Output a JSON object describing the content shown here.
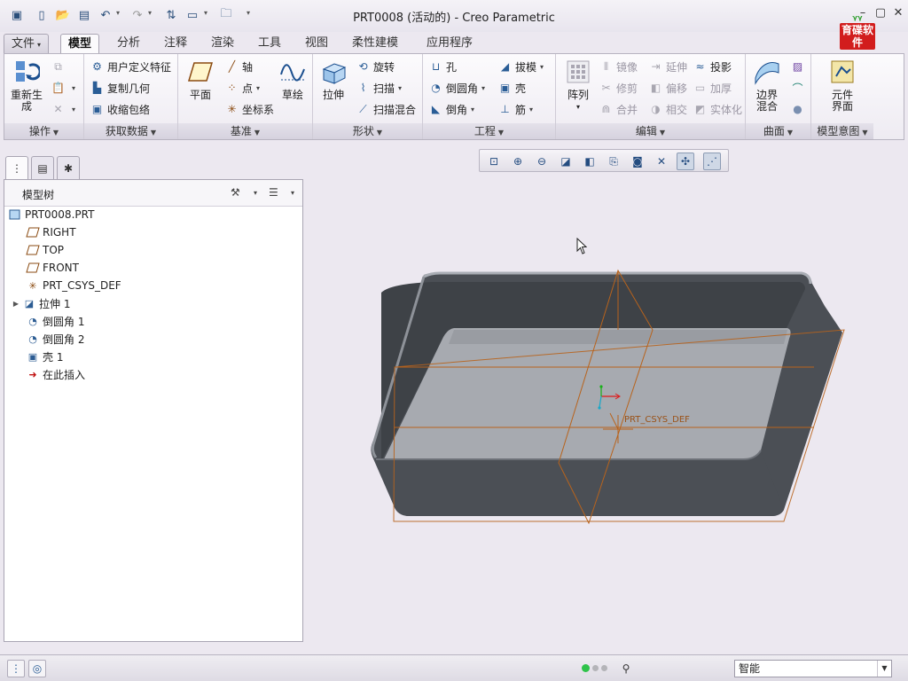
{
  "window": {
    "title": "PRT0008 (活动的) - Creo Parametric",
    "brand_logo_text": "育碟软件"
  },
  "tabs": [
    {
      "label": "文件",
      "has_dropdown": true
    },
    {
      "label": "模型",
      "active": true
    },
    {
      "label": "分析"
    },
    {
      "label": "注释"
    },
    {
      "label": "渲染"
    },
    {
      "label": "工具"
    },
    {
      "label": "视图"
    },
    {
      "label": "柔性建模"
    },
    {
      "label": "应用程序"
    }
  ],
  "ribbon": {
    "groups": {
      "operations": "操作",
      "get_data": "获取数据",
      "datum": "基准",
      "shapes": "形状",
      "engineering": "工程",
      "editing": "编辑",
      "surfaces": "曲面",
      "model_intent": "模型意图"
    },
    "regenerate": "重新生成",
    "user_defined_feature": "用户定义特征",
    "copy_geometry": "复制几何",
    "shrinkwrap": "收缩包络",
    "plane": "平面",
    "axis": "轴",
    "point": "点",
    "csys": "坐标系",
    "sketch": "草绘",
    "extrude": "拉伸",
    "revolve": "旋转",
    "sweep": "扫描",
    "swept_blend": "扫描混合",
    "hole": "孔",
    "round": "倒圆角",
    "chamfer": "倒角",
    "draft": "拔模",
    "shell": "壳",
    "rib": "筋",
    "pattern": "阵列",
    "mirror": "镜像",
    "trim": "修剪",
    "merge": "合并",
    "extend": "延伸",
    "offset": "偏移",
    "intersect": "相交",
    "project": "投影",
    "thicken": "加厚",
    "solidify": "实体化",
    "boundary_blend": "边界混合",
    "component_interface": "元件界面"
  },
  "model_tree": {
    "title": "模型树",
    "items": [
      {
        "label": "PRT0008.PRT",
        "icon": "part-icon"
      },
      {
        "label": "RIGHT",
        "icon": "datum-plane-icon"
      },
      {
        "label": "TOP",
        "icon": "datum-plane-icon"
      },
      {
        "label": "FRONT",
        "icon": "datum-plane-icon"
      },
      {
        "label": "PRT_CSYS_DEF",
        "icon": "csys-icon"
      },
      {
        "label": "拉伸 1",
        "icon": "extrude-icon",
        "expandable": true
      },
      {
        "label": "倒圆角 1",
        "icon": "round-icon"
      },
      {
        "label": "倒圆角 2",
        "icon": "round-icon"
      },
      {
        "label": "壳 1",
        "icon": "shell-icon"
      },
      {
        "label": "在此插入",
        "icon": "insert-here-arrow-icon"
      }
    ]
  },
  "viewport": {
    "csys_label": "PRT_CSYS_DEF"
  },
  "statusbar": {
    "filter_value": "智能"
  },
  "colors": {
    "background": "#ece8f0",
    "datum_plane": "#b8631c",
    "model_dark": "#4b4f55",
    "model_floor": "#a7aab0"
  }
}
